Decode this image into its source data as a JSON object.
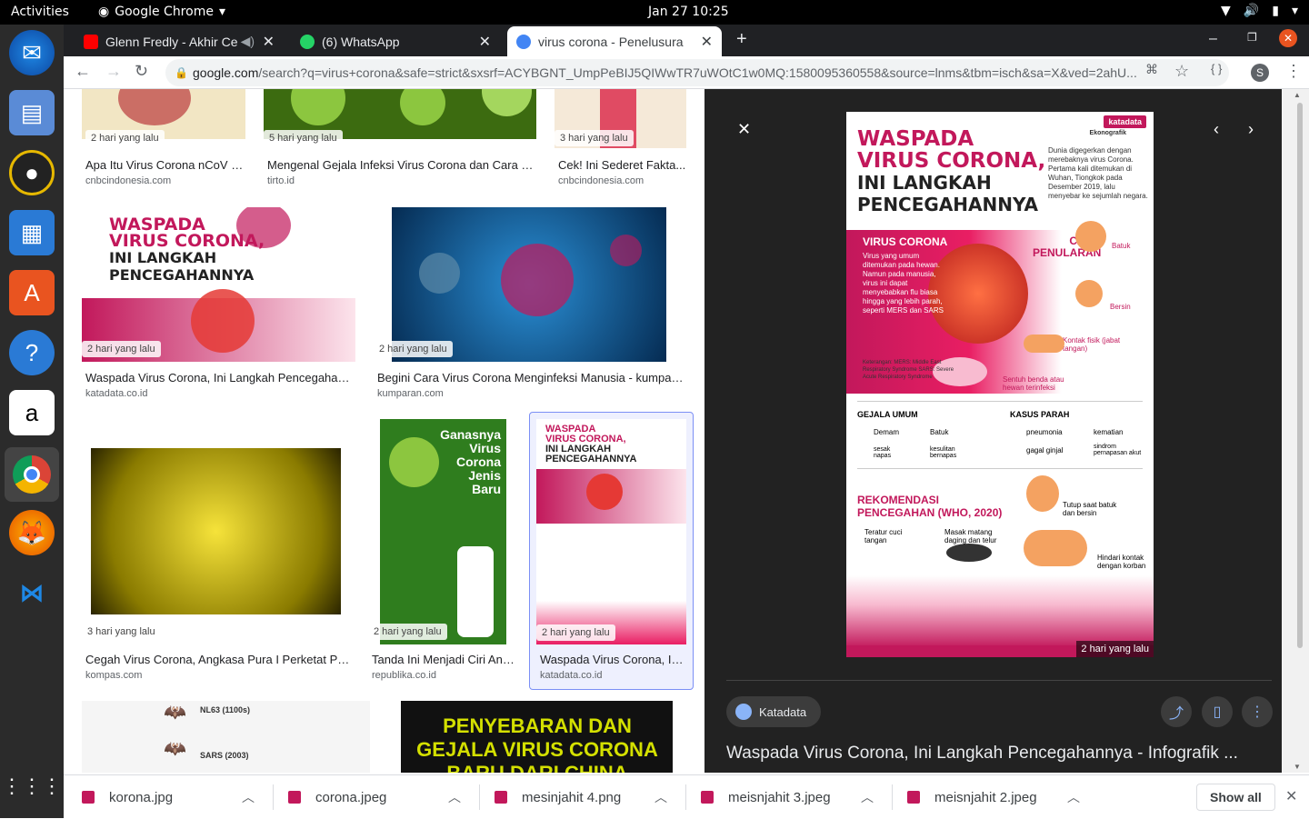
{
  "system": {
    "activities": "Activities",
    "app_name": "Google Chrome",
    "clock": "Jan 27  10:25"
  },
  "tabs": [
    {
      "title": "Glenn Fredly - Akhir Ce",
      "favicon_color": "#ff0000"
    },
    {
      "title": "(6) WhatsApp",
      "favicon_color": "#25d366"
    },
    {
      "title": "virus corona - Penelusura",
      "favicon_color": "#4285f4"
    }
  ],
  "url": {
    "host": "google.com",
    "path": "/search?q=virus+corona&safe=strict&sxsrf=ACYBGNT_UmpPeBIJ5QIWwTR7uWOtC1w0MQ:1580095360558&source=lnms&tbm=isch&sa=X&ved=2ahU..."
  },
  "profile_initial": "S",
  "results": [
    {
      "ago": "2 hari yang lalu",
      "title": "Apa Itu Virus Corona nCoV y...",
      "source": "cnbcindonesia.com",
      "color": "#f2e6c4"
    },
    {
      "ago": "5 hari yang lalu",
      "title": "Mengenal Gejala Infeksi Virus Corona dan Cara M...",
      "source": "tirto.id",
      "color": "#3c6b10"
    },
    {
      "ago": "3 hari yang lalu",
      "title": "Cek! Ini Sederet Fakta...",
      "source": "cnbcindonesia.com",
      "color": "#f5e9d8"
    },
    {
      "ago": "2 hari yang lalu",
      "title": "Waspada Virus Corona, Ini Langkah Pencegahann...",
      "source": "katadata.co.id",
      "color": "#ffffff"
    },
    {
      "ago": "2 hari yang lalu",
      "title": "Begini Cara Virus Corona Menginfeksi Manusia - kumpara...",
      "source": "kumparan.com",
      "color": "#0b4a7a"
    },
    {
      "ago": "3 hari yang lalu",
      "title": "Cegah Virus Corona, Angkasa Pura I Perketat Pe...",
      "source": "kompas.com",
      "color": "#c9b800"
    },
    {
      "ago": "2 hari yang lalu",
      "title": "Tanda Ini Menjadi Ciri And...",
      "source": "republika.co.id",
      "color": "#2f7d1e"
    },
    {
      "ago": "2 hari yang lalu",
      "title": "Waspada Virus Corona, In...",
      "source": "katadata.co.id",
      "color": "#ffffff"
    }
  ],
  "bottom_row": {
    "left_label_1": "NL63 (1100s)",
    "left_label_2": "SARS (2003)",
    "right_title": "PENYEBARAN DAN GEJALA VIRUS CORONA BARU DARI CHINA"
  },
  "infographic": {
    "brand": "katadata",
    "brand_sub": "Ekonografik",
    "headline": [
      "WASPADA",
      "VIRUS CORONA,",
      "INI LANGKAH",
      "PENCEGAHANNYA"
    ],
    "intro": "Dunia digegerkan dengan merebaknya virus Corona. Pertama kali ditemukan di Wuhan, Tiongkok pada Desember 2019, lalu menyebar ke sejumlah negara.",
    "virus_heading": "VIRUS CORONA",
    "virus_text": "Virus yang umum ditemukan pada hewan. Namun pada manusia, virus ini dapat menyebabkan flu biasa hingga yang lebih parah, seperti MERS dan SARS",
    "transmission_heading": "CARA PENULARAN",
    "transmission": [
      "Batuk",
      "Bersin",
      "Kontak fisik (jabat tangan)",
      "Sentuh benda atau hewan terinfeksi"
    ],
    "notes": "Keterangan: MERS: Middle East Respiratory Syndrome SARS: Severe Acute Respiratory Syndrome",
    "symptoms_heading": "GEJALA UMUM",
    "symptoms": [
      "Demam",
      "Batuk",
      "sesak napas",
      "kesulitan bernapas"
    ],
    "severe_heading": "KASUS PARAH",
    "severe": [
      "pneumonia",
      "kematian",
      "gagal ginjal",
      "sindrom pernapasan akut"
    ],
    "prevention_heading": "REKOMENDASI PENCEGAHAN (WHO, 2020)",
    "prevention": [
      "Tutup saat batuk dan bersin",
      "Teratur cuci tangan",
      "Masak matang daging dan telur",
      "Hindari kontak dengan korban"
    ],
    "ago": "2 hari yang lalu"
  },
  "side_panel": {
    "source_name": "Katadata",
    "title": "Waspada Virus Corona, Ini Langkah Pencegahannya - Infografik ..."
  },
  "downloads": [
    "korona.jpg",
    "corona.jpeg",
    "mesinjahit 4.png",
    "meisnjahit 3.jpeg",
    "meisnjahit 2.jpeg"
  ],
  "show_all": "Show all"
}
